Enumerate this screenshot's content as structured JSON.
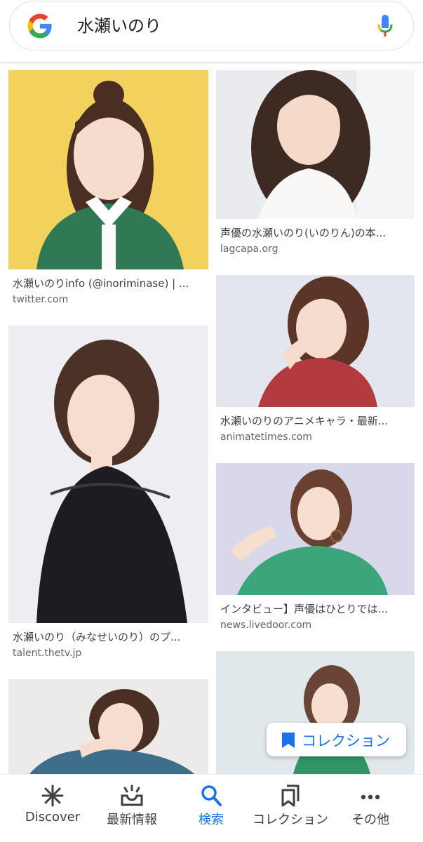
{
  "search": {
    "query": "水瀬いのり"
  },
  "results": [
    {
      "title": "水瀬いのりinfo (@inoriminase) | ...",
      "source": "twitter.com"
    },
    {
      "title": "声優の水瀬いのり(いのりん)の本...",
      "source": "lagcapa.org"
    },
    {
      "title": "水瀬いのり（みなせいのり）のプ...",
      "source": "talent.thetv.jp"
    },
    {
      "title": "水瀬いのりのアニメキャラ・最新...",
      "source": "animatetimes.com"
    },
    {
      "title": "インタビュー】声優はひとりでは...",
      "source": "news.livedoor.com"
    },
    {
      "title": "",
      "source": ""
    },
    {
      "title": "",
      "source": ""
    }
  ],
  "collection_chip": {
    "label": "コレクション"
  },
  "nav": [
    {
      "label": "Discover",
      "icon": "asterisk-icon"
    },
    {
      "label": "最新情報",
      "icon": "inbox-updates-icon"
    },
    {
      "label": "検索",
      "icon": "search-icon",
      "active": true
    },
    {
      "label": "コレクション",
      "icon": "bookmarks-icon"
    },
    {
      "label": "その他",
      "icon": "more-dots-icon"
    }
  ],
  "colors": {
    "accent": "#1a73e8",
    "text": "#3c4043",
    "secondary": "#5f6368"
  }
}
